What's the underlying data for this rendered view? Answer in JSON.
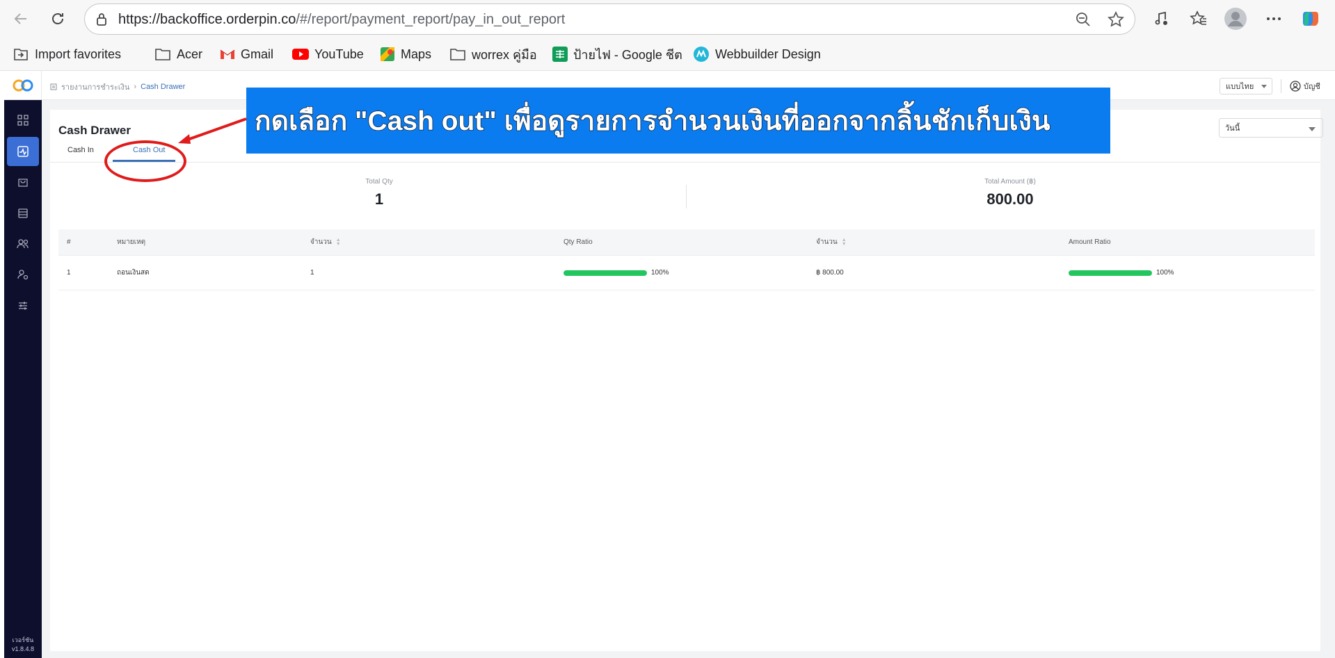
{
  "browser": {
    "url_domain": "https://backoffice.orderpin.co",
    "url_path": "/#/report/payment_report/pay_in_out_report",
    "bookmarks": [
      {
        "label": "Import favorites",
        "icon": "import-icon"
      },
      {
        "label": "Acer",
        "icon": "folder-icon"
      },
      {
        "label": "Gmail",
        "icon": "gmail-icon"
      },
      {
        "label": "YouTube",
        "icon": "youtube-icon"
      },
      {
        "label": "Maps",
        "icon": "maps-icon"
      },
      {
        "label": "worrex คู่มือ",
        "icon": "folder-icon"
      },
      {
        "label": "ป้ายไฟ - Google ชีต",
        "icon": "sheets-icon"
      },
      {
        "label": "Webbuilder Design",
        "icon": "webbuilder-icon"
      }
    ]
  },
  "header": {
    "breadcrumb_parent": "รายงานการชำระเงิน",
    "breadcrumb_current": "Cash Drawer",
    "language": "แบบไทย",
    "account": "บัญชี"
  },
  "sidebar": {
    "version_label": "เวอร์ชัน",
    "version": "v1.8.4.8"
  },
  "page": {
    "title": "Cash Drawer",
    "tabs": [
      {
        "label": "Cash In",
        "active": false
      },
      {
        "label": "Cash Out",
        "active": true
      }
    ],
    "date_filter": "วันนี้"
  },
  "summary": {
    "total_qty_label": "Total Qty",
    "total_qty": "1",
    "total_amount_label": "Total Amount (฿)",
    "total_amount": "800.00"
  },
  "table": {
    "headers": [
      "#",
      "หมายเหตุ",
      "จำนวน",
      "Qty Ratio",
      "จำนวน",
      "Amount Ratio"
    ],
    "rows": [
      {
        "index": "1",
        "note": "ถอนเงินสด",
        "qty": "1",
        "qty_ratio": 100,
        "qty_ratio_label": "100%",
        "amount": "฿ 800.00",
        "amount_ratio": 100,
        "amount_ratio_label": "100%"
      }
    ]
  },
  "annotation": {
    "text": "กดเลือก \"Cash out\" เพื่อดูรายการจำนวนเงินที่ออกจากลิ้นชักเก็บเงิน"
  },
  "colors": {
    "accent": "#3b6fb6",
    "sidebar_bg": "#0d0f2c",
    "progress": "#22c55e",
    "annotation_bg": "#0a7cf0",
    "annotation_border": "#e01b1b"
  }
}
